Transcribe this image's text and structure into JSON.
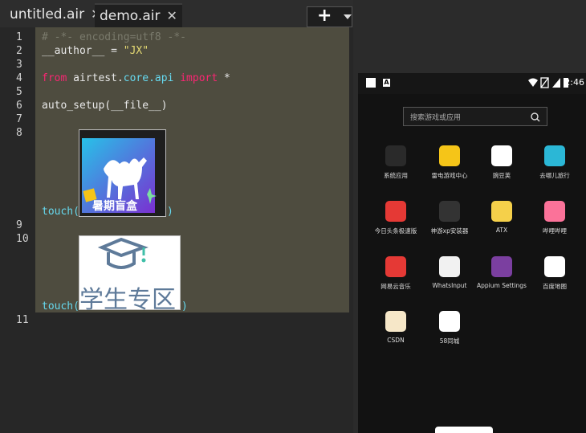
{
  "tabs": [
    {
      "label": "untitled.air",
      "close": "✕"
    },
    {
      "label": "demo.air",
      "close": "✕"
    }
  ],
  "toolbar": {
    "add_label": "+"
  },
  "line_numbers": [
    "1",
    "2",
    "3",
    "4",
    "5",
    "6",
    "7",
    "8",
    "9",
    "10",
    "11"
  ],
  "code": {
    "l1": "# -*- encoding=utf8 -*-",
    "l2_a": "__author__ = ",
    "l2_b": "\"JX\"",
    "l4_a": "from",
    "l4_b": " airtest.",
    "l4_c": "core.api",
    "l4_d": " import",
    "l4_e": " *",
    "l6": "auto_setup(__file__)",
    "touch1_fn": "touch(",
    "touch1_end": ")",
    "touch2_fn": "touch(",
    "touch2_end": ")"
  },
  "thumb1": {
    "caption": "暑期盲盒"
  },
  "thumb2": {
    "caption": "学生专区"
  },
  "device": {
    "status": {
      "time": "2:46"
    },
    "search": {
      "placeholder": "搜索游戏或应用"
    },
    "apps": [
      {
        "label": "系统应用",
        "color": "#2a2a2a"
      },
      {
        "label": "雷电游戏中心",
        "color": "#f5c518"
      },
      {
        "label": "豌豆荚",
        "color": "#ffffff"
      },
      {
        "label": "去哪儿旅行",
        "color": "#2bb7d6"
      },
      {
        "label": "今日头条极速版",
        "color": "#e53935"
      },
      {
        "label": "神游xp安装器",
        "color": "#333333"
      },
      {
        "label": "ATX",
        "color": "#f5d04a"
      },
      {
        "label": "哔哩哔哩",
        "color": "#fb7299"
      },
      {
        "label": "网易云音乐",
        "color": "#e53935"
      },
      {
        "label": "WhatsInput",
        "color": "#f1f1f1"
      },
      {
        "label": "Appium Settings",
        "color": "#7b3fa0"
      },
      {
        "label": "百度地图",
        "color": "#ffffff"
      },
      {
        "label": "CSDN",
        "color": "#f6e7c8"
      },
      {
        "label": "58同城",
        "color": "#ffffff"
      }
    ]
  }
}
